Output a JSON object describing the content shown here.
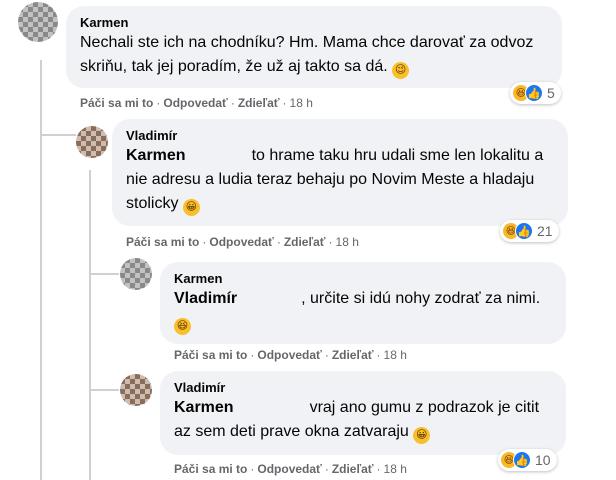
{
  "comments": [
    {
      "author": "Karmen",
      "text": "Nechali ste ich na chodníku? Hm. Mama chce darovať za odvoz skriňu, tak jej poradím, že už aj takto sa dá.",
      "emoji": "wink-emoji",
      "actions": {
        "like": "Páči sa mi to",
        "reply": "Odpovedať",
        "share": "Zdieľať",
        "time": "18 h"
      },
      "reactions": {
        "count": "5",
        "icons": [
          "haha",
          "like"
        ]
      }
    },
    {
      "author": "Vladimír",
      "mention": "Karmen",
      "text": "to hrame taku hru udali sme len lokalitu a nie adresu a ludia teraz behaju po Novim Meste a hladaju stolicky",
      "emoji": "grin-emoji",
      "actions": {
        "like": "Páči sa mi to",
        "reply": "Odpovedať",
        "share": "Zdieľať",
        "time": "18 h"
      },
      "reactions": {
        "count": "21",
        "icons": [
          "haha",
          "like"
        ]
      }
    },
    {
      "author": "Karmen",
      "mention": "Vladimír",
      "text": ", určite si idú nohy zodrať za nimi.",
      "emoji": "laugh-emoji",
      "actions": {
        "like": "Páči sa mi to",
        "reply": "Odpovedať",
        "share": "Zdieľať",
        "time": "18 h"
      }
    },
    {
      "author": "Vladimír",
      "mention": "Karmen",
      "text": "vraj ano gumu z podrazok je citit az sem deti prave okna zatvaraju",
      "emoji": "grin-emoji",
      "actions": {
        "like": "Páči sa mi to",
        "reply": "Odpovedať",
        "share": "Zdieľať",
        "time": "18 h"
      },
      "reactions": {
        "count": "10",
        "icons": [
          "haha",
          "like"
        ]
      }
    }
  ],
  "separator": "·",
  "colors": {
    "bubble": "#f0f2f5",
    "meta": "#65676b",
    "like_blue": "#1877f2",
    "haha_yellow": "#f7b928"
  }
}
